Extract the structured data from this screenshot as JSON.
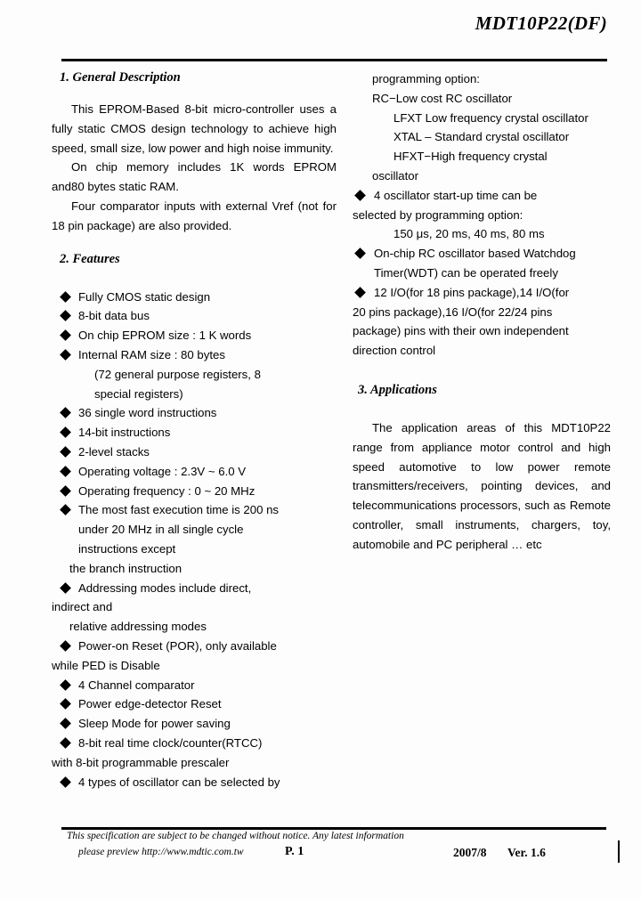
{
  "header": {
    "doc_title": "MDT10P22(DF)"
  },
  "left_column": {
    "section1": {
      "heading": "1. General Description",
      "paragraphs": [
        "This EPROM-Based 8-bit micro-controller uses a fully static CMOS design technology to achieve high speed, small size, low power and high noise immunity.",
        "On chip memory includes 1K words EPROM and80 bytes static RAM.",
        "Four comparator inputs with external Vref (not for 18 pin package) are also provided."
      ]
    },
    "section2": {
      "heading": "2. Features",
      "items": [
        {
          "text": "Fully CMOS static design",
          "bullet": true
        },
        {
          "text": "8-bit data bus",
          "bullet": true
        },
        {
          "text": "On chip EPROM size : 1 K words",
          "bullet": true
        },
        {
          "text": "Internal RAM size : 80 bytes",
          "bullet": true
        },
        {
          "text": "(72 general purpose registers, 8",
          "bullet": false,
          "style": "sub"
        },
        {
          "text": "special registers)",
          "bullet": false,
          "style": "sub"
        },
        {
          "text": "36 single word instructions",
          "bullet": true
        },
        {
          "text": "14-bit instructions",
          "bullet": true
        },
        {
          "text": "2-level stacks",
          "bullet": true
        },
        {
          "text": "Operating voltage : 2.3V ~ 6.0 V",
          "bullet": true
        },
        {
          "text": "Operating frequency : 0 ~ 20 MHz",
          "bullet": true
        },
        {
          "text": "The most fast execution time is 200 ns",
          "bullet": true,
          "justify": true
        },
        {
          "text": "under 20 MHz in all single cycle",
          "bullet": false,
          "style": "sub2",
          "justify": true
        },
        {
          "text": "instructions except",
          "bullet": false,
          "style": "sub2"
        },
        {
          "text": "the branch instruction",
          "bullet": false,
          "style": "sub3"
        },
        {
          "text": "Addressing modes include direct,",
          "bullet": true
        },
        {
          "text": "indirect and",
          "bullet": false,
          "style": "flush"
        },
        {
          "text": "relative addressing modes",
          "bullet": false,
          "style": "sub3"
        },
        {
          "text": "Power-on Reset (POR), only available",
          "bullet": true
        },
        {
          "text": "while PED is Disable",
          "bullet": false,
          "style": "flush"
        },
        {
          "text": "4 Channel comparator",
          "bullet": true
        },
        {
          "text": "Power edge-detector Reset",
          "bullet": true
        },
        {
          "text": "Sleep Mode for power saving",
          "bullet": true
        },
        {
          "text": "8-bit real time clock/counter(RTCC)",
          "bullet": true
        },
        {
          "text": "with 8-bit programmable prescaler",
          "bullet": false,
          "style": "flush"
        },
        {
          "text": "4 types of oscillator can be selected by",
          "bullet": true
        }
      ]
    }
  },
  "right_column": {
    "continued_features": [
      {
        "text": "programming option:",
        "bullet": false,
        "style": "osc-line"
      },
      {
        "text": "RC−Low cost RC oscillator",
        "bullet": false,
        "style": "osc-line"
      },
      {
        "text": "LFXT   Low frequency crystal oscillator",
        "bullet": false,
        "style": "osc-sub"
      },
      {
        "text": "XTAL – Standard crystal oscillator",
        "bullet": false,
        "style": "osc-sub"
      },
      {
        "text": "HFXT−High frequency crystal",
        "bullet": false,
        "style": "osc-sub"
      },
      {
        "text": "oscillator",
        "bullet": false,
        "style": "osc-line"
      },
      {
        "text": "4 oscillator start-up time can be",
        "bullet": true
      },
      {
        "text": "selected by programming option:",
        "bullet": false,
        "style": "cont"
      },
      {
        "text": "150 μs, 20 ms, 40 ms, 80 ms",
        "bullet": false,
        "style": "osc-sub"
      },
      {
        "text": "On-chip RC oscillator based Watchdog",
        "bullet": true
      },
      {
        "text": "Timer(WDT) can be operated freely",
        "bullet": false,
        "style": "cont-in"
      },
      {
        "text": "12 I/O(for 18 pins package),14 I/O(for",
        "bullet": true
      },
      {
        "text": "20 pins package),16 I/O(for 22/24 pins",
        "bullet": false,
        "style": "cont"
      },
      {
        "text": "package) pins with their own independent",
        "bullet": false,
        "style": "cont"
      },
      {
        "text": "direction control",
        "bullet": false,
        "style": "cont"
      }
    ],
    "section3": {
      "heading": "3. Applications",
      "paragraph": "The application areas of this MDT10P22 range from appliance motor control and high speed automotive to low power remote transmitters/receivers, pointing devices, and telecommunications processors, such as Remote controller, small instruments, chargers, toy, automobile and PC peripheral … etc"
    }
  },
  "footer": {
    "notice": "This specification are subject to be changed without notice. Any latest information",
    "url_line": "please preview http://www.mdtic.com.tw",
    "page": "P. 1",
    "date": "2007/8",
    "version": "Ver. 1.6"
  }
}
